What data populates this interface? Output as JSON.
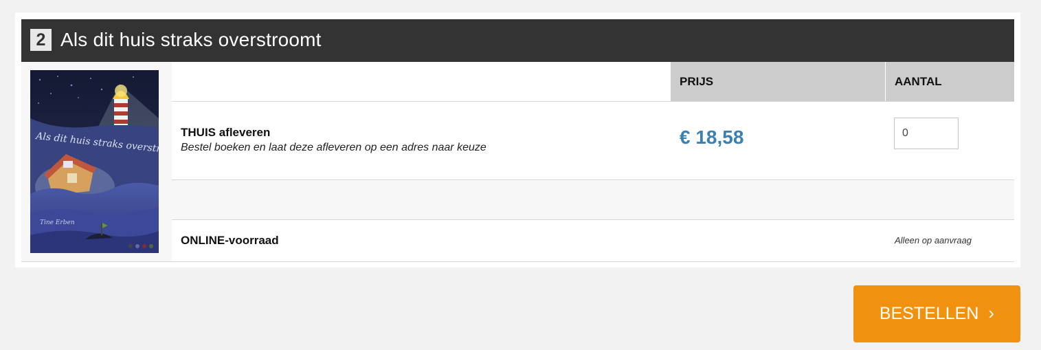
{
  "product": {
    "step_number": "2",
    "title": "Als dit huis straks overstroomt",
    "cover_icon": "book-cover-image"
  },
  "table": {
    "price_header": "PRIJS",
    "quantity_header": "AANTAL"
  },
  "delivery_option": {
    "title": "THUIS afleveren",
    "description": "Bestel boeken en laat deze afleveren op een adres naar keuze",
    "price": "€ 18,58",
    "quantity_value": "0",
    "price_color": "#3a80b4"
  },
  "online_stock": {
    "label": "ONLINE-voorraad",
    "availability": "Alleen op aanvraag"
  },
  "order_button": {
    "label": "BESTELLEN",
    "chevron": "›",
    "color": "#f0920f"
  }
}
